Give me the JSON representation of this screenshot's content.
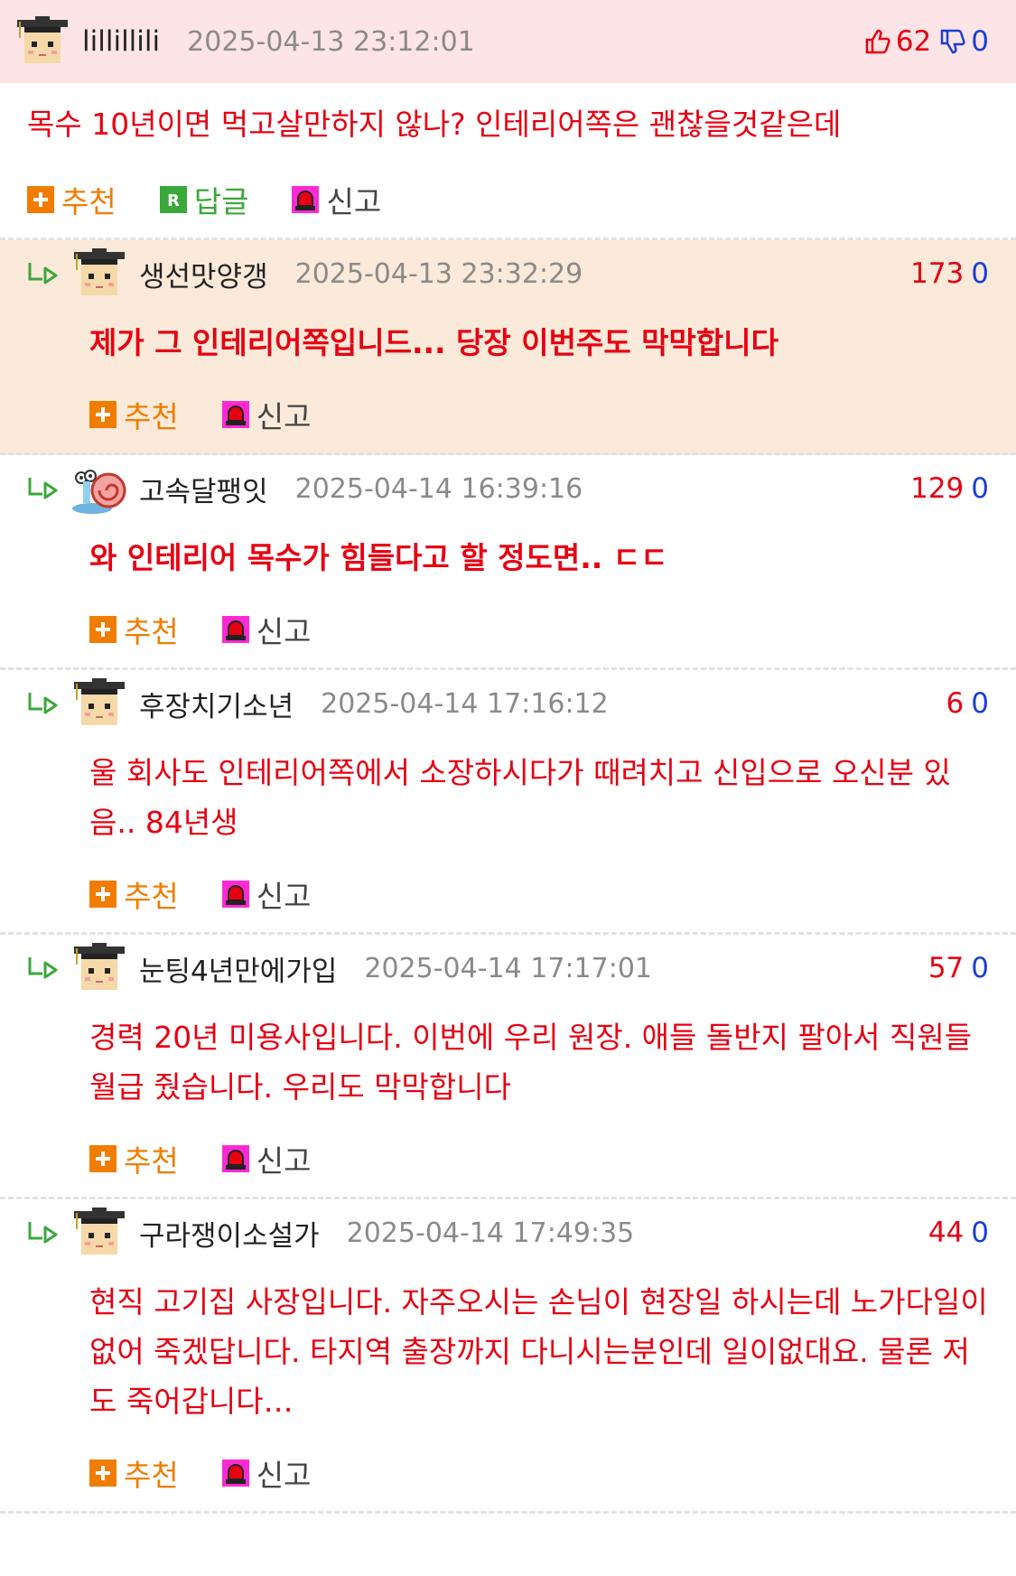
{
  "colors": {
    "accent_red": "#e60012",
    "blue": "#1a3fd6",
    "orange": "#f07d00",
    "green": "#3aa83a",
    "root_header_bg": "#fde4e6",
    "highlight_bg": "#fbe9d9"
  },
  "labels": {
    "recommend": "추천",
    "reply": "답글",
    "report": "신고"
  },
  "root": {
    "nick": "lillillili",
    "date": "2025-04-13 23:12:01",
    "up": "62",
    "down": "0",
    "text": "목수 10년이면 먹고살만하지 않나? 인테리어쪽은 괜찮을것같은데",
    "avatar_icon": "scholar-avatar-icon"
  },
  "replies": [
    {
      "nick": "생선맛양갱",
      "date": "2025-04-13 23:32:29",
      "up": "173",
      "down": "0",
      "text": "제가 그 인테리어쪽입니드... 당장 이번주도 막막합니다",
      "bold": true,
      "highlight": true,
      "avatar_icon": "scholar-avatar-icon"
    },
    {
      "nick": "고속달팽잇",
      "date": "2025-04-14 16:39:16",
      "up": "129",
      "down": "0",
      "text": "와 인테리어 목수가 힘들다고 할 정도면.. ㄷㄷ",
      "bold": true,
      "highlight": false,
      "avatar_icon": "snail-avatar-icon"
    },
    {
      "nick": "후장치기소년",
      "date": "2025-04-14 17:16:12",
      "up": "6",
      "down": "0",
      "text": "울 회사도 인테리어쪽에서 소장하시다가 때려치고 신입으로 오신분 있음.. 84년생",
      "bold": false,
      "highlight": false,
      "avatar_icon": "scholar-avatar-icon"
    },
    {
      "nick": "눈팅4년만에가입",
      "date": "2025-04-14 17:17:01",
      "up": "57",
      "down": "0",
      "text": "경력 20년 미용사입니다. 이번에 우리 원장. 애들 돌반지 팔아서 직원들 월급 줬습니다. 우리도 막막합니다",
      "bold": false,
      "highlight": false,
      "avatar_icon": "scholar-avatar-icon"
    },
    {
      "nick": "구라쟁이소설가",
      "date": "2025-04-14 17:49:35",
      "up": "44",
      "down": "0",
      "text": "현직 고기집 사장입니다. 자주오시는 손님이 현장일 하시는데 노가다일이없어 죽겠답니다. 타지역 출장까지 다니시는분인데 일이없대요. 물론 저도 죽어갑니다…",
      "bold": false,
      "highlight": false,
      "avatar_icon": "scholar-avatar-icon"
    }
  ]
}
